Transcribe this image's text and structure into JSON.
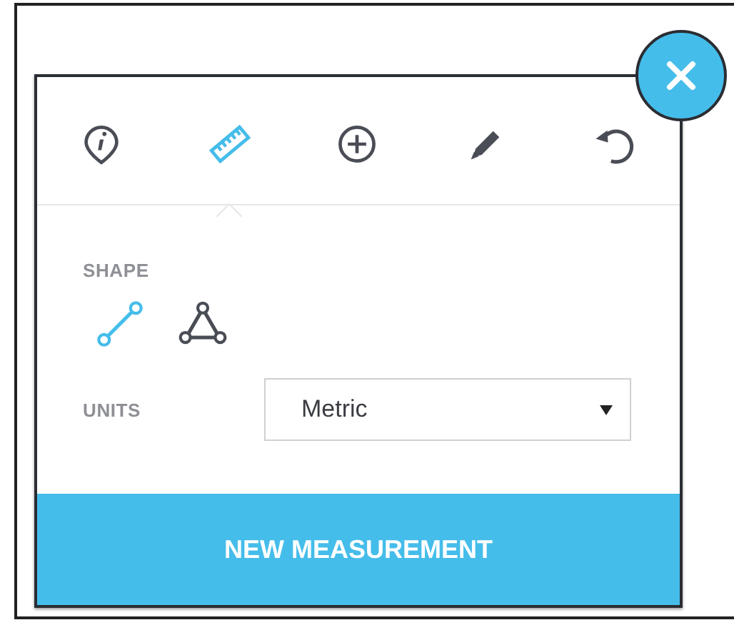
{
  "close_button": {
    "kind": "close"
  },
  "toolbar": [
    {
      "kind": "info",
      "selected": false
    },
    {
      "kind": "ruler",
      "selected": true
    },
    {
      "kind": "add",
      "selected": false
    },
    {
      "kind": "pencil",
      "selected": false
    },
    {
      "kind": "undo",
      "selected": false
    }
  ],
  "shape": {
    "label": "SHAPE",
    "options": [
      {
        "kind": "line",
        "selected": true
      },
      {
        "kind": "polygon",
        "selected": false
      }
    ]
  },
  "units": {
    "label": "UNITS",
    "value": "Metric"
  },
  "primary_button": "NEW MEASUREMENT"
}
